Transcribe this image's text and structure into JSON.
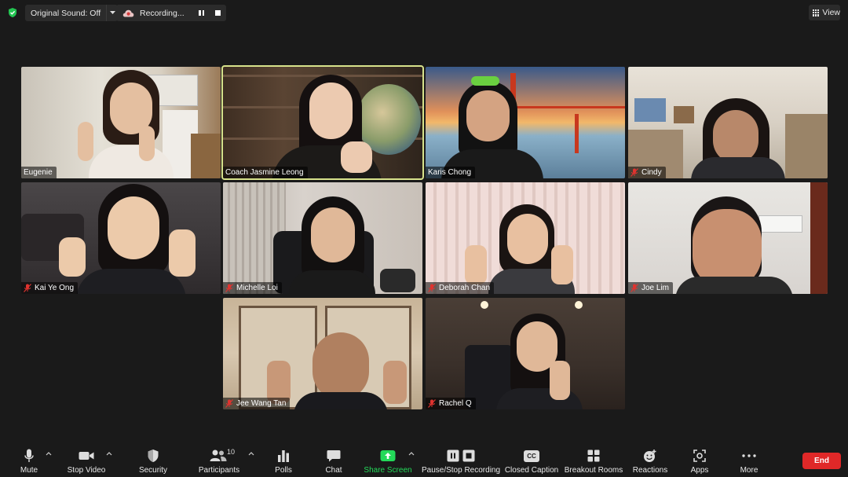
{
  "topbar": {
    "original_sound_label": "Original Sound: Off",
    "recording_label": "Recording...",
    "view_label": "View",
    "icons": [
      "shield-icon",
      "chevron-down-icon",
      "cloud-icon",
      "pause-icon",
      "stop-icon",
      "grid-icon"
    ]
  },
  "participants": [
    {
      "name": "Eugenie",
      "muted": false
    },
    {
      "name": "Coach Jasmine Leong",
      "muted": false,
      "active_speaker": true
    },
    {
      "name": "Karis Chong",
      "muted": false
    },
    {
      "name": "Cindy",
      "muted": true
    },
    {
      "name": "Kai Ye Ong",
      "muted": true
    },
    {
      "name": "Michelle Loi",
      "muted": true
    },
    {
      "name": "Deborah Chan",
      "muted": true
    },
    {
      "name": "Joe Lim",
      "muted": true
    },
    {
      "name": "Jee Wang Tan",
      "muted": true
    },
    {
      "name": "Rachel Q",
      "muted": true
    }
  ],
  "toolbar": {
    "mute": "Mute",
    "stop_video": "Stop Video",
    "security": "Security",
    "participants": "Participants",
    "participants_count": "10",
    "polls": "Polls",
    "chat": "Chat",
    "share_screen": "Share Screen",
    "pause_stop_recording": "Pause/Stop Recording",
    "closed_caption": "Closed Caption",
    "closed_caption_badge": "CC",
    "breakout_rooms": "Breakout Rooms",
    "reactions": "Reactions",
    "apps": "Apps",
    "more": "More",
    "end": "End"
  },
  "colors": {
    "background": "#1a1a1a",
    "active_speaker_border": "#d7e28b",
    "share_screen_green": "#23d959",
    "end_red": "#e02828",
    "muted_red": "#e0332f"
  }
}
